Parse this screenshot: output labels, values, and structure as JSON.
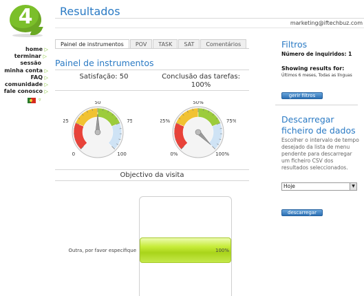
{
  "logo": {
    "text": "4"
  },
  "nav": {
    "items": [
      "home",
      "terminar sessão",
      "minha conta",
      "FAQ",
      "comunidade",
      "fale conosco"
    ],
    "lang_arrow": "▿"
  },
  "page": {
    "title": "Resultados",
    "email": "marketing@iftechbuz.com"
  },
  "tabs": [
    "Painel de instrumentos",
    "POV",
    "TASK",
    "SAT",
    "Comentários"
  ],
  "dashboard": {
    "title": "Painel de instrumentos",
    "satisfaction_label": "Satisfação: 50",
    "completion_label": "Conclusão das tarefas: 100%"
  },
  "gauge_sat": {
    "value": 50,
    "ticks": [
      "0",
      "25",
      "50",
      "75",
      "100"
    ]
  },
  "gauge_conc": {
    "value": 100,
    "ticks": [
      "0%",
      "25%",
      "50%",
      "75%",
      "100%"
    ]
  },
  "colors": {
    "accent": "#2a7ac4",
    "brand_green": "#7bbf2a",
    "bar": "#b8e02a"
  },
  "chart_data": {
    "type": "bar",
    "title": "Objectivo da visita",
    "categories": [
      "Outra, por favor especifique"
    ],
    "values": [
      100
    ],
    "value_labels": [
      "100%"
    ],
    "orientation": "horizontal",
    "xlim": [
      0,
      100
    ]
  },
  "filters": {
    "title": "Filtros",
    "respondents": "Número de inquiridos: 1",
    "showing_label": "Showing results for:",
    "showing_detail": "Últimos 6 meses, Todas as línguas",
    "manage_button": "gerir filtros"
  },
  "download": {
    "title": "Descarregar ficheiro de dados",
    "description": "Escolher o intervalo de tempo desejado da lista de menu pendente para descarregar um ficheiro CSV dos resultados seleccionados.",
    "select_value": "Hoje",
    "button": "descarregar"
  }
}
